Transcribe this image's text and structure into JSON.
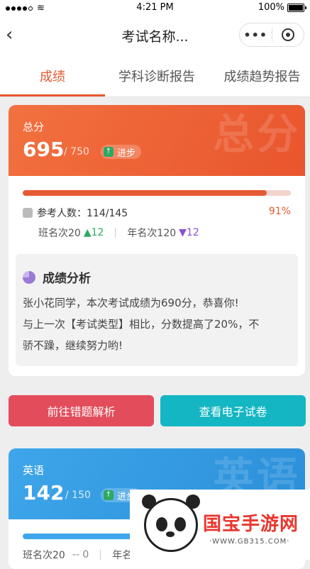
{
  "status_bar": {
    "time": "4:21 PM",
    "battery": "100%"
  },
  "nav": {
    "title": "考试名称...",
    "more": "•••"
  },
  "tabs": [
    "成绩",
    "学科诊断报告",
    "成绩趋势报告"
  ],
  "total_card": {
    "label": "总分",
    "watermark": "总分",
    "score": "695",
    "full": "/ 750",
    "badge": "进步",
    "progress": 0.91,
    "participants": "参考人数：114/145",
    "percent": "91%",
    "class_rank": "班名次20",
    "class_change": "▲12",
    "grade_rank": "年名次120",
    "grade_change": "▼12"
  },
  "analysis": {
    "title": "成绩分析",
    "line1": "张小花同学，本次考试成绩为690分，恭喜你!",
    "line2": "与上一次【考试类型】相比，分数提高了20%，不",
    "line3": "骄不躁，继续努力哟!"
  },
  "buttons": {
    "wrong": "前往错题解析",
    "paper": "查看电子试卷"
  },
  "english_card": {
    "label": "英语",
    "watermark": "英语",
    "score": "142",
    "full": "/ 150",
    "badge": "进步",
    "class_rank": "班名次20",
    "class_change": "-- 0",
    "grade_rank": "年名"
  },
  "overlay": {
    "brand": "国宝手游网",
    "url": "·WWW.GB315.COM·"
  },
  "colors": {
    "accent": "#e8572f",
    "english": "#3ea6ea",
    "up": "#2fa861",
    "down": "#8a4fd6"
  }
}
